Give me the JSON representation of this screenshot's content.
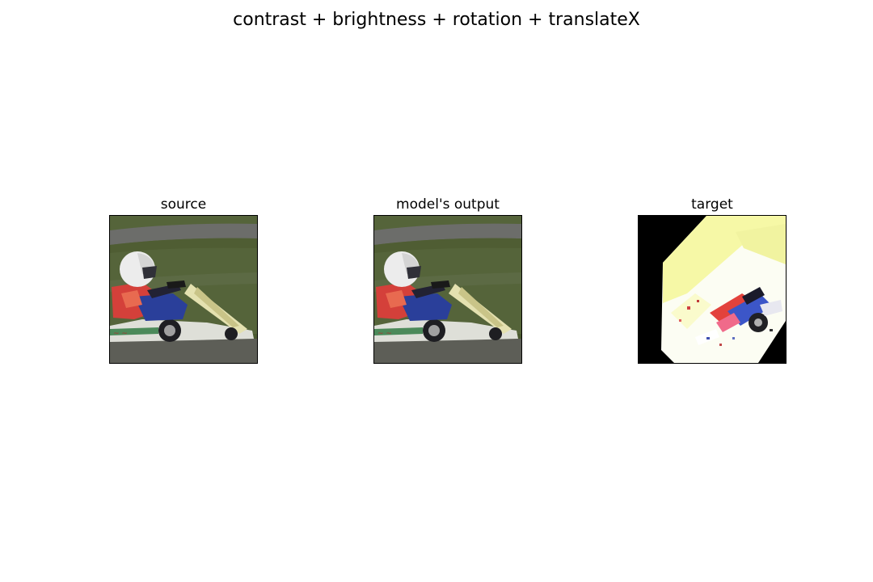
{
  "figure": {
    "title": "contrast + brightness + rotation + translateX"
  },
  "panels": [
    {
      "title": "source"
    },
    {
      "title": "model's output"
    },
    {
      "title": "target"
    }
  ],
  "colors": {
    "track_grass": "#56653a",
    "track_asphalt": "#6a6b68",
    "helmet": "#e8e8e8",
    "suit_red": "#d8403a",
    "suit_blue": "#2a3f9a",
    "kart_white": "#dcdcd4",
    "target_bg": "#000000",
    "target_yellow": "#f5f7a8"
  }
}
